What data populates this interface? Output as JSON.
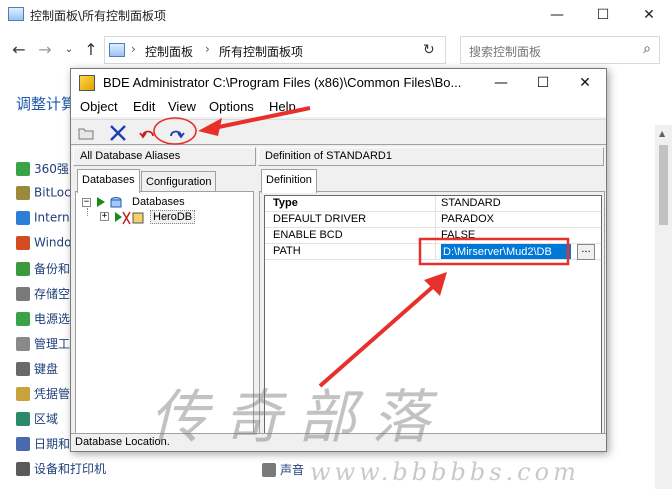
{
  "control_panel": {
    "title": "控制面板\\所有控制面板项",
    "breadcrumb": [
      "控制面板",
      "所有控制面板项"
    ],
    "search_placeholder": "搜索控制面板",
    "heading": "调整计算",
    "items": [
      {
        "label": "360强",
        "icon": "shield-icon",
        "color": "#3aa34a"
      },
      {
        "label": "BitLoc",
        "icon": "bitlocker-icon",
        "color": "#9a8a3a"
      },
      {
        "label": "Interne",
        "icon": "internet-icon",
        "color": "#2c7fd6"
      },
      {
        "label": "Windo",
        "icon": "windows-icon",
        "color": "#d24b22"
      },
      {
        "label": "备份和",
        "icon": "backup-icon",
        "color": "#3c9a3c"
      },
      {
        "label": "存储空",
        "icon": "storage-icon",
        "color": "#7a7a7a"
      },
      {
        "label": "电源选",
        "icon": "power-icon",
        "color": "#3aa34a"
      },
      {
        "label": "管理工",
        "icon": "admin-tools-icon",
        "color": "#8a8a8a"
      },
      {
        "label": "键盘",
        "icon": "keyboard-icon",
        "color": "#6a6a6a"
      },
      {
        "label": "凭据管",
        "icon": "credential-icon",
        "color": "#c8a23a"
      },
      {
        "label": "区域",
        "icon": "region-icon",
        "color": "#2a8a6a"
      },
      {
        "label": "日期和",
        "icon": "calendar-icon",
        "color": "#4a6ab0"
      },
      {
        "label": "设备和打印机",
        "icon": "printer-icon",
        "color": "#5a5a5a"
      }
    ],
    "right_item": "声音"
  },
  "bde": {
    "title": "BDE Administrator  C:\\Program Files (x86)\\Common Files\\Bo...",
    "menus": [
      "Object",
      "Edit",
      "View",
      "Options",
      "Help"
    ],
    "left_header": "All Database Aliases",
    "right_header": "Definition of STANDARD1",
    "tabs_left": [
      "Databases",
      "Configuration"
    ],
    "tabs_right": [
      "Definition"
    ],
    "tree": {
      "root": "Databases",
      "child": "HeroDB"
    },
    "definition": [
      {
        "key": "Type",
        "value": "STANDARD"
      },
      {
        "key": "DEFAULT DRIVER",
        "value": "PARADOX"
      },
      {
        "key": "ENABLE BCD",
        "value": "FALSE"
      },
      {
        "key": "PATH",
        "value": "D:\\Mirserver\\Mud2\\DB"
      }
    ],
    "ellipsis": "...",
    "status": "Database Location."
  },
  "watermark": "传奇部落",
  "watermark_sub": "www.bbbbbs.com",
  "colors": {
    "accent": "#0078d7",
    "annotation": "#e8302a",
    "link": "#1e3f7a"
  }
}
